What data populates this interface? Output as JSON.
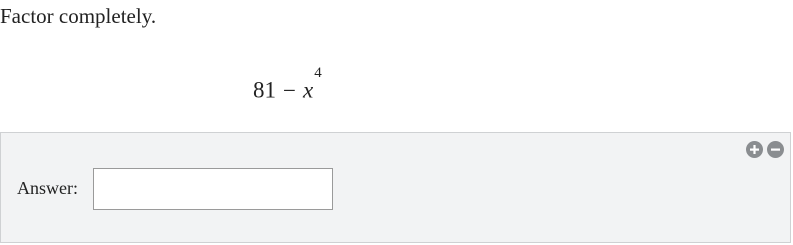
{
  "question": {
    "prompt": "Factor completely.",
    "expression": {
      "constant": "81",
      "operator": "−",
      "variable": "x",
      "exponent": "4"
    }
  },
  "answer": {
    "label": "Answer:",
    "value": "",
    "placeholder": ""
  },
  "controls": {
    "add_icon": "plus-circle-icon",
    "remove_icon": "minus-circle-icon",
    "color": "#8a8d90"
  },
  "colors": {
    "panel_background": "#f2f3f4",
    "panel_border": "#cfd1d3",
    "text": "#222222"
  }
}
